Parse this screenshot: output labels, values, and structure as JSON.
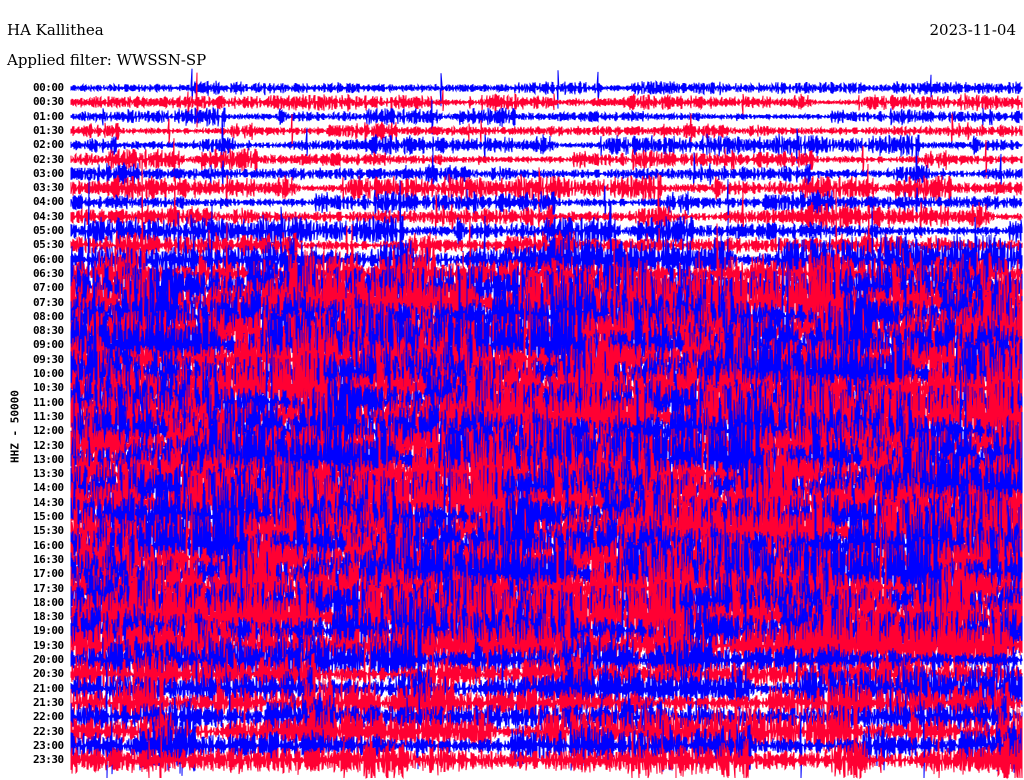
{
  "header": {
    "station": "HA Kallithea",
    "filter": "Applied filter: WWSSN-SP",
    "date": "2023-11-04"
  },
  "chart_data": {
    "type": "line",
    "title": "HA Kallithea",
    "ylabel": "HHZ - 50000",
    "row_labels": [
      "00:00",
      "00:30",
      "01:00",
      "01:30",
      "02:00",
      "02:30",
      "03:00",
      "03:30",
      "04:00",
      "04:30",
      "05:00",
      "05:30",
      "06:00",
      "06:30",
      "07:00",
      "07:30",
      "08:00",
      "08:30",
      "09:00",
      "09:30",
      "10:00",
      "10:30",
      "11:00",
      "11:30",
      "12:00",
      "12:30",
      "13:00",
      "13:30",
      "14:00",
      "14:30",
      "15:00",
      "15:30",
      "16:00",
      "16:30",
      "17:00",
      "17:30",
      "18:00",
      "18:30",
      "19:00",
      "19:30",
      "20:00",
      "20:30",
      "21:00",
      "21:30",
      "22:00",
      "22:30",
      "23:00",
      "23:30"
    ],
    "series_colors": [
      "#0000ff",
      "#ff0033"
    ],
    "minutes_per_row": 30
  }
}
